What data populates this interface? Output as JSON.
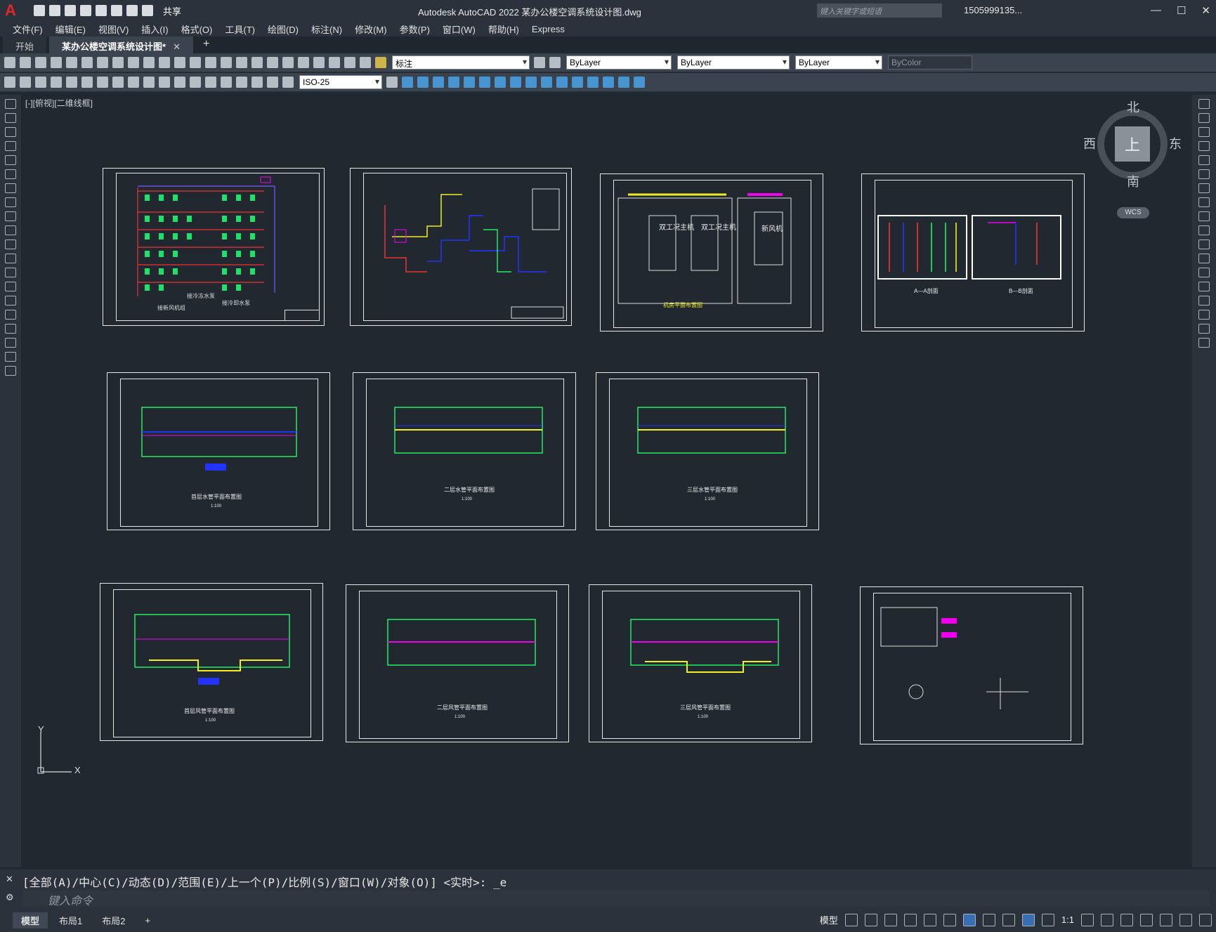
{
  "app": {
    "title": "Autodesk AutoCAD 2022    某办公楼空调系统设计图.dwg",
    "logo": "A",
    "share": "共享",
    "search_placeholder": "键入关键字或短语",
    "user": "1505999135...",
    "window_controls": [
      "—",
      "☐",
      "✕"
    ]
  },
  "menu": [
    "文件(F)",
    "编辑(E)",
    "视图(V)",
    "插入(I)",
    "格式(O)",
    "工具(T)",
    "绘图(D)",
    "标注(N)",
    "修改(M)",
    "参数(P)",
    "窗口(W)",
    "帮助(H)",
    "Express"
  ],
  "tabs": [
    {
      "label": "开始"
    },
    {
      "label": "某办公楼空调系统设计图*"
    }
  ],
  "tab_plus": "+",
  "toolbar": {
    "layer": "标注",
    "color": "ByLayer",
    "linetype": "ByLayer",
    "lineweight": "ByLayer",
    "plotstyle": "ByColor",
    "dimstyle": "ISO-25"
  },
  "viewport": {
    "label": "[-][俯视][二维线框]"
  },
  "sheets": [
    {
      "caption": "",
      "labels": [
        "接新风机组",
        "接冷冻水泵",
        "接冷却水泵"
      ]
    },
    {
      "caption": ""
    },
    {
      "caption": "机房平面布置图",
      "labels": [
        "双工况主机",
        "双工况主机",
        "新风机"
      ]
    },
    {
      "caption": "",
      "labels": [
        "A—A剖面",
        "B—B剖面"
      ]
    },
    {
      "caption": "首层水管平面布置图",
      "scale": "1:100"
    },
    {
      "caption": "二层水管平面布置图",
      "scale": "1:100"
    },
    {
      "caption": "三层水管平面布置图",
      "scale": "1:100"
    },
    {
      "caption": "首层风管平面布置图",
      "scale": "1:100"
    },
    {
      "caption": "二层风管平面布置图",
      "scale": "1:100"
    },
    {
      "caption": "三层风管平面布置图",
      "scale": "1:100"
    },
    {
      "caption": ""
    }
  ],
  "viewcube": {
    "north": "北",
    "south": "南",
    "west": "西",
    "east": "东",
    "face": "上",
    "wcs": "WCS"
  },
  "ucs": {
    "x": "X",
    "y": "Y"
  },
  "command": {
    "history": "[全部(A)/中心(C)/动态(D)/范围(E)/上一个(P)/比例(S)/窗口(W)/对象(O)] <实时>: _e",
    "placeholder": "键入命令"
  },
  "status": {
    "tabs": [
      "模型",
      "布局1",
      "布局2"
    ],
    "model_label": "模型",
    "scale": "1:1",
    "plus": "+"
  }
}
